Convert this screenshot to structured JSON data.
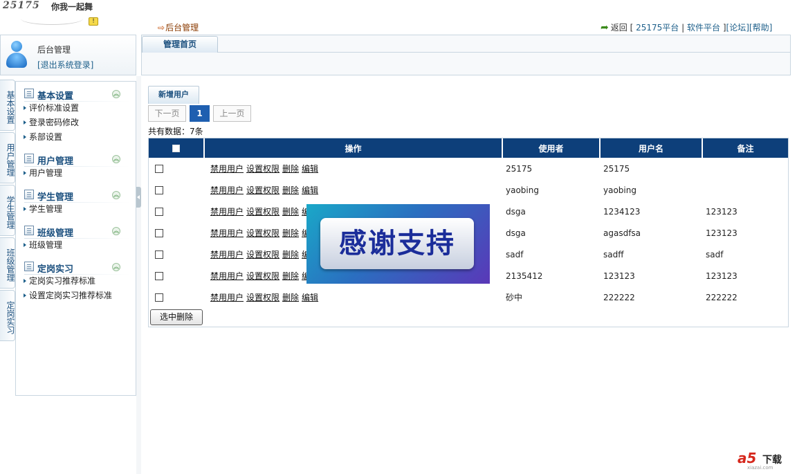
{
  "logo": {
    "brand": "25175",
    "slogan": "你我一起舞",
    "badge": "!"
  },
  "breadcrumb": {
    "arrow": "⇨",
    "label": "后台管理"
  },
  "toplinks": {
    "back": "返回",
    "open_bracket": "[",
    "platform": "25175平台",
    "sep1": "|",
    "software": "软件平台",
    "close_bracket": "]",
    "forum": "[论坛]",
    "help": "[帮助]"
  },
  "user": {
    "name": "后台管理",
    "logout": "[退出系统登录]"
  },
  "tabs": {
    "home": "管理首页"
  },
  "vtabs": [
    "基本设置",
    "用户管理",
    "学生管理",
    "班级管理",
    "定岗实习"
  ],
  "menu": [
    {
      "title": "基本设置",
      "items": [
        "评价标准设置",
        "登录密码修改",
        "系部设置"
      ]
    },
    {
      "title": "用户管理",
      "items": [
        "用户管理"
      ]
    },
    {
      "title": "学生管理",
      "items": [
        "学生管理"
      ]
    },
    {
      "title": "班级管理",
      "items": [
        "班级管理"
      ]
    },
    {
      "title": "定岗实习",
      "items": [
        "定岗实习推荐标准",
        "设置定岗实习推荐标准"
      ]
    }
  ],
  "content": {
    "new_user": "新增用户",
    "pager": {
      "next": "下一页",
      "current": "1",
      "prev": "上一页"
    },
    "total": "共有数据：7条",
    "delete_selected": "选中删除"
  },
  "table": {
    "headers": {
      "action": "操作",
      "user": "使用者",
      "username": "用户名",
      "note": "备注"
    },
    "actions": {
      "disable": "禁用用户",
      "perm": "设置权限",
      "delete": "删除",
      "edit": "编辑"
    },
    "rows": [
      {
        "user": "25175",
        "username": "25175",
        "note": ""
      },
      {
        "user": "yaobing",
        "username": "yaobing",
        "note": ""
      },
      {
        "user": "dsga",
        "username": "1234123",
        "note": "123123"
      },
      {
        "user": "dsga",
        "username": "agasdfsa",
        "note": "123123"
      },
      {
        "user": "sadf",
        "username": "sadff",
        "note": "sadf"
      },
      {
        "user": "2135412",
        "username": "123123",
        "note": "123123"
      },
      {
        "user": "砂中",
        "username": "222222",
        "note": "222222"
      }
    ]
  },
  "banner": {
    "text": "感谢支持"
  },
  "watermark": {
    "logo": "a5",
    "label": "下载",
    "url": "xiazai.com"
  },
  "colors": {
    "header_bg": "#0d3f7a",
    "accent": "#1a4f7e",
    "page_current": "#1f5fb0",
    "link": "#1d5f8a"
  }
}
